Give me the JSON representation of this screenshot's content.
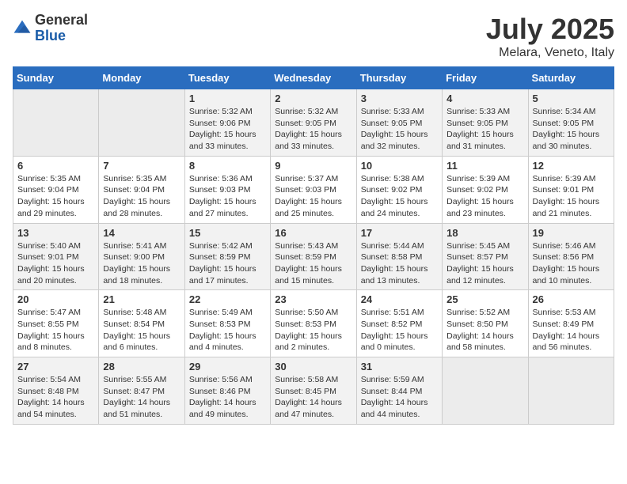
{
  "logo": {
    "general": "General",
    "blue": "Blue"
  },
  "title": "July 2025",
  "location": "Melara, Veneto, Italy",
  "days_of_week": [
    "Sunday",
    "Monday",
    "Tuesday",
    "Wednesday",
    "Thursday",
    "Friday",
    "Saturday"
  ],
  "weeks": [
    [
      {
        "day": "",
        "info": ""
      },
      {
        "day": "",
        "info": ""
      },
      {
        "day": "1",
        "info": "Sunrise: 5:32 AM\nSunset: 9:06 PM\nDaylight: 15 hours and 33 minutes."
      },
      {
        "day": "2",
        "info": "Sunrise: 5:32 AM\nSunset: 9:05 PM\nDaylight: 15 hours and 33 minutes."
      },
      {
        "day": "3",
        "info": "Sunrise: 5:33 AM\nSunset: 9:05 PM\nDaylight: 15 hours and 32 minutes."
      },
      {
        "day": "4",
        "info": "Sunrise: 5:33 AM\nSunset: 9:05 PM\nDaylight: 15 hours and 31 minutes."
      },
      {
        "day": "5",
        "info": "Sunrise: 5:34 AM\nSunset: 9:05 PM\nDaylight: 15 hours and 30 minutes."
      }
    ],
    [
      {
        "day": "6",
        "info": "Sunrise: 5:35 AM\nSunset: 9:04 PM\nDaylight: 15 hours and 29 minutes."
      },
      {
        "day": "7",
        "info": "Sunrise: 5:35 AM\nSunset: 9:04 PM\nDaylight: 15 hours and 28 minutes."
      },
      {
        "day": "8",
        "info": "Sunrise: 5:36 AM\nSunset: 9:03 PM\nDaylight: 15 hours and 27 minutes."
      },
      {
        "day": "9",
        "info": "Sunrise: 5:37 AM\nSunset: 9:03 PM\nDaylight: 15 hours and 25 minutes."
      },
      {
        "day": "10",
        "info": "Sunrise: 5:38 AM\nSunset: 9:02 PM\nDaylight: 15 hours and 24 minutes."
      },
      {
        "day": "11",
        "info": "Sunrise: 5:39 AM\nSunset: 9:02 PM\nDaylight: 15 hours and 23 minutes."
      },
      {
        "day": "12",
        "info": "Sunrise: 5:39 AM\nSunset: 9:01 PM\nDaylight: 15 hours and 21 minutes."
      }
    ],
    [
      {
        "day": "13",
        "info": "Sunrise: 5:40 AM\nSunset: 9:01 PM\nDaylight: 15 hours and 20 minutes."
      },
      {
        "day": "14",
        "info": "Sunrise: 5:41 AM\nSunset: 9:00 PM\nDaylight: 15 hours and 18 minutes."
      },
      {
        "day": "15",
        "info": "Sunrise: 5:42 AM\nSunset: 8:59 PM\nDaylight: 15 hours and 17 minutes."
      },
      {
        "day": "16",
        "info": "Sunrise: 5:43 AM\nSunset: 8:59 PM\nDaylight: 15 hours and 15 minutes."
      },
      {
        "day": "17",
        "info": "Sunrise: 5:44 AM\nSunset: 8:58 PM\nDaylight: 15 hours and 13 minutes."
      },
      {
        "day": "18",
        "info": "Sunrise: 5:45 AM\nSunset: 8:57 PM\nDaylight: 15 hours and 12 minutes."
      },
      {
        "day": "19",
        "info": "Sunrise: 5:46 AM\nSunset: 8:56 PM\nDaylight: 15 hours and 10 minutes."
      }
    ],
    [
      {
        "day": "20",
        "info": "Sunrise: 5:47 AM\nSunset: 8:55 PM\nDaylight: 15 hours and 8 minutes."
      },
      {
        "day": "21",
        "info": "Sunrise: 5:48 AM\nSunset: 8:54 PM\nDaylight: 15 hours and 6 minutes."
      },
      {
        "day": "22",
        "info": "Sunrise: 5:49 AM\nSunset: 8:53 PM\nDaylight: 15 hours and 4 minutes."
      },
      {
        "day": "23",
        "info": "Sunrise: 5:50 AM\nSunset: 8:53 PM\nDaylight: 15 hours and 2 minutes."
      },
      {
        "day": "24",
        "info": "Sunrise: 5:51 AM\nSunset: 8:52 PM\nDaylight: 15 hours and 0 minutes."
      },
      {
        "day": "25",
        "info": "Sunrise: 5:52 AM\nSunset: 8:50 PM\nDaylight: 14 hours and 58 minutes."
      },
      {
        "day": "26",
        "info": "Sunrise: 5:53 AM\nSunset: 8:49 PM\nDaylight: 14 hours and 56 minutes."
      }
    ],
    [
      {
        "day": "27",
        "info": "Sunrise: 5:54 AM\nSunset: 8:48 PM\nDaylight: 14 hours and 54 minutes."
      },
      {
        "day": "28",
        "info": "Sunrise: 5:55 AM\nSunset: 8:47 PM\nDaylight: 14 hours and 51 minutes."
      },
      {
        "day": "29",
        "info": "Sunrise: 5:56 AM\nSunset: 8:46 PM\nDaylight: 14 hours and 49 minutes."
      },
      {
        "day": "30",
        "info": "Sunrise: 5:58 AM\nSunset: 8:45 PM\nDaylight: 14 hours and 47 minutes."
      },
      {
        "day": "31",
        "info": "Sunrise: 5:59 AM\nSunset: 8:44 PM\nDaylight: 14 hours and 44 minutes."
      },
      {
        "day": "",
        "info": ""
      },
      {
        "day": "",
        "info": ""
      }
    ]
  ]
}
